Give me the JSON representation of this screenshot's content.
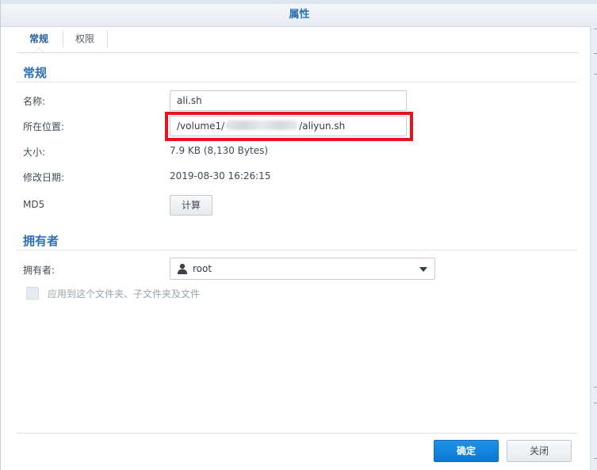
{
  "dialog": {
    "title": "属性"
  },
  "tabs": [
    {
      "label": "常规",
      "active": true
    },
    {
      "label": "权限",
      "active": false
    }
  ],
  "general": {
    "section_title": "常规",
    "name_label": "名称:",
    "name_value": "ali.sh",
    "location_label": "所在位置:",
    "location_prefix": "/volume1/",
    "location_suffix": "/aliyun.sh",
    "size_label": "大小:",
    "size_value": "7.9 KB (8,130 Bytes)",
    "modified_label": "修改日期:",
    "modified_value": "2019-08-30 16:26:15",
    "md5_label": "MD5",
    "md5_button": "计算"
  },
  "owner": {
    "section_title": "拥有者",
    "owner_label": "拥有者:",
    "owner_value": "root",
    "apply_label": "应用到这个文件夹、子文件夹及文件",
    "apply_checked": false
  },
  "footer": {
    "ok_button": "确定",
    "close_button": "关闭"
  },
  "colors": {
    "accent": "#2d6fb7",
    "primary_button": "#1c93e8",
    "highlight": "#e8141b"
  },
  "icons": {
    "owner": "user-icon",
    "dropdown": "chevron-down-icon"
  }
}
